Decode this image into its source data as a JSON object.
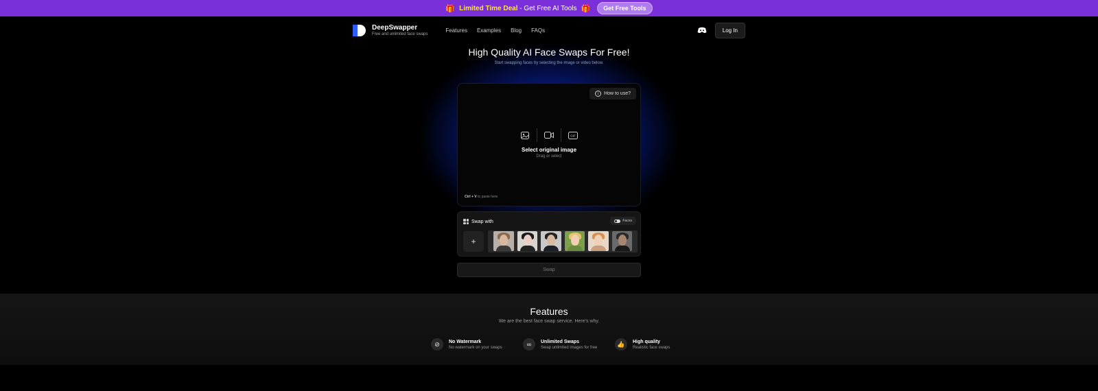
{
  "promo": {
    "deal_label": "Limited Time Deal",
    "deal_text": " - Get Free AI Tools",
    "cta_label": "Get Free Tools"
  },
  "nav": {
    "brand": "DeepSwapper",
    "tagline": "Free and unlimited face swaps",
    "links": [
      "Features",
      "Examples",
      "Blog",
      "FAQs"
    ],
    "login_label": "Log In"
  },
  "hero": {
    "title": "High Quality AI Face Swaps For Free!",
    "subtitle": "Start swapping faces by selecting the image or video below."
  },
  "upload": {
    "howto_label": "How to use?",
    "select_title": "Select original image",
    "select_sub": "Drag or select",
    "paste_keys": "Ctrl + V",
    "paste_text": " to paste here",
    "gif_label": "GIF"
  },
  "swap_panel": {
    "label": "Swap with",
    "faces_toggle_label": "Faces",
    "add_label": "+",
    "faces": [
      {
        "skin": "#d9b8a0",
        "hair": "#8a6a4a",
        "body": "#3a3a3a",
        "bg": "#b8b0a8"
      },
      {
        "skin": "#e8d0c4",
        "hair": "#1a1a1a",
        "body": "#222222",
        "bg": "#d8d4d0"
      },
      {
        "skin": "#d8b8a0",
        "hair": "#222222",
        "body": "#1b1f2a",
        "bg": "#c8c8c8"
      },
      {
        "skin": "#f0d0b0",
        "hair": "#e8c070",
        "body": "#6a8a40",
        "bg": "#7aa04a"
      },
      {
        "skin": "#f0d0b8",
        "hair": "#d89050",
        "body": "#c8a080",
        "bg": "#e8d8c8"
      },
      {
        "skin": "#a88670",
        "hair": "#2a2a2a",
        "body": "#1a1a1a",
        "bg": "#6a6a6a"
      }
    ]
  },
  "swap_button_label": "Swap",
  "features": {
    "title": "Features",
    "subtitle": "We are the best face swap service. Here's why.",
    "items": [
      {
        "title": "No Watermark",
        "desc": "No watermark on your swaps",
        "icon": "⊘"
      },
      {
        "title": "Unlimited Swaps",
        "desc": "Swap unlimited images for free",
        "icon": "∞"
      },
      {
        "title": "High quality",
        "desc": "Realistic face swaps",
        "icon": "👍"
      }
    ]
  }
}
